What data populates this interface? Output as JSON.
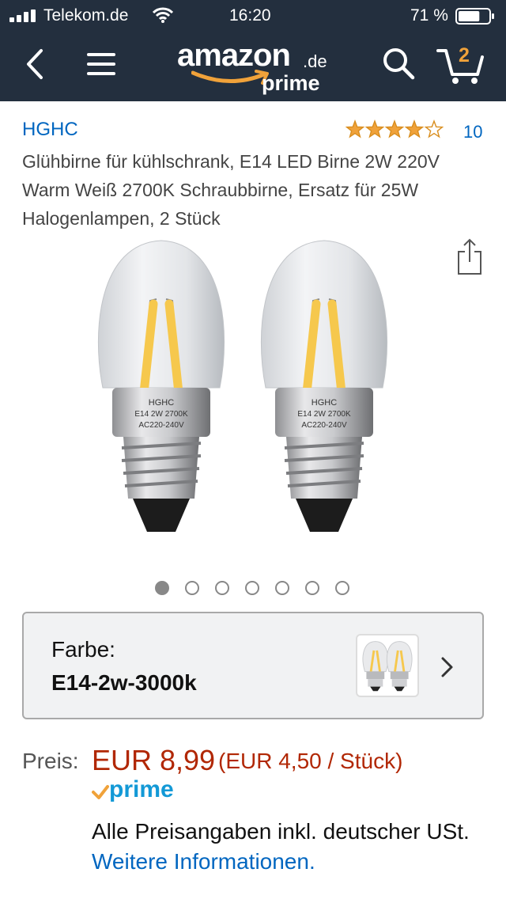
{
  "status_bar": {
    "carrier": "Telekom.de",
    "time": "16:20",
    "battery": "71 %",
    "battery_level": 0.71
  },
  "header": {
    "logo_word": "amazon",
    "logo_tld": ".de",
    "logo_prime": "prime",
    "cart_count": "2",
    "brand_color": "#232f3e",
    "accent_color": "#f0a23a"
  },
  "product": {
    "brand": "HGHC",
    "rating": 4,
    "rating_max": 5,
    "rating_count": "10",
    "title": "Glühbirne für kühlschrank, E14 LED Birne 2W 220V Warm Weiß 2700K Schraubbirne, Ersatz für 25W Halogenlampen, 2 Stück",
    "image_label_lines": [
      "HGHC",
      "E14 2W 2700K",
      "AC220-240V"
    ],
    "image_count": 7,
    "image_index": 0
  },
  "variant": {
    "label": "Farbe:",
    "value": "E14-2w-3000k"
  },
  "price": {
    "label": "Preis:",
    "amount": "EUR 8,99",
    "unit_price": "(EUR 4,50 / Stück)",
    "prime": "prime",
    "tax_text": "Alle Preisangaben inkl. deutscher USt.",
    "more_info_link": "Weitere Informationen.",
    "price_color": "#b12704",
    "link_color": "#0066c0"
  }
}
